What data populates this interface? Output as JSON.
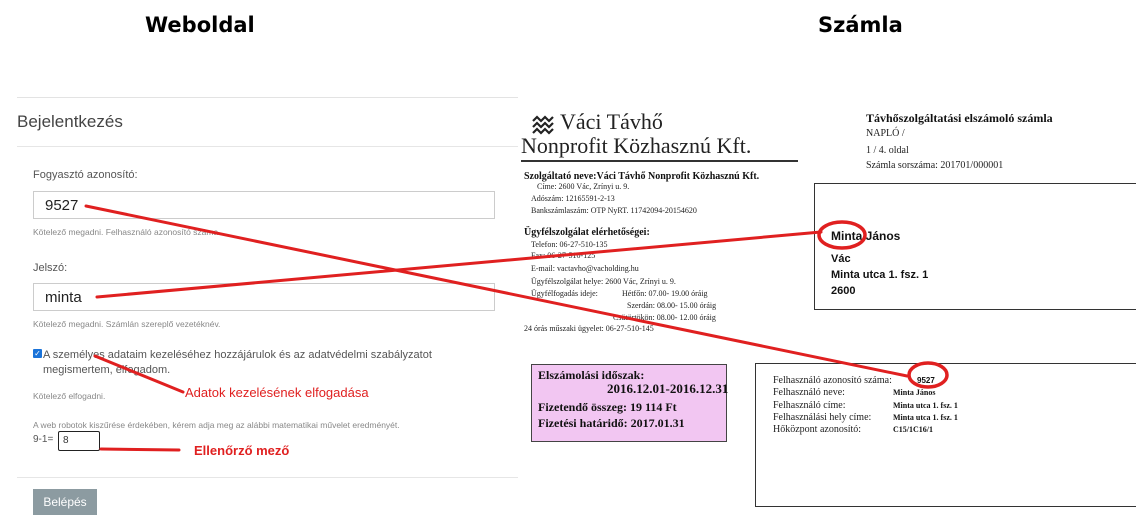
{
  "headings": {
    "left": "Weboldal",
    "right": "Számla"
  },
  "login": {
    "title": "Bejelentkezés",
    "consumer_id_label": "Fogyasztó azonosító:",
    "consumer_id_value": "9527",
    "consumer_id_help": "Kötelező megadni. Felhasználó azonosító száma.",
    "password_label": "Jelszó:",
    "password_value": "minta",
    "password_help": "Kötelező megadni. Számlán szereplő vezetéknév.",
    "consent_text": "A személyes adataim kezeléséhez hozzájárulok és az adatvédelmi szabályzatot megismertem, elfogadom.",
    "consent_help": "Kötelező elfogadni.",
    "captcha_prompt": "A web robotok kiszűrése érdekében, kérem adja meg az alábbi matematikai művelet eredményét.",
    "captcha_equation": "9-1=",
    "captcha_value": "8",
    "login_button": "Belépés"
  },
  "annotations": {
    "consent": "Adatok kezelésének elfogadása",
    "captcha": "Ellenőrző mező",
    "color": "#e02020"
  },
  "invoice": {
    "logo_line1": "Váci Távhő",
    "logo_line2": "Nonprofit Közhasznú Kft.",
    "doc_title": "Távhőszolgáltatási elszámoló számla",
    "naplo": "NAPLÓ /",
    "page": "1 / 4. oldal",
    "serial": "Számla sorszáma:  201701/000001",
    "provider": "Szolgáltató neve:Váci Távhő Nonprofit Közhasznú Kft.",
    "address": "Címe: 2600 Vác, Zrínyi u. 9.",
    "tax_no": "Adószám: 12165591-2-13",
    "bank": "Bankszámlaszám: OTP NyRT. 11742094-20154620",
    "service_head": "Ügyfélszolgálat elérhetőségei:",
    "phone": "Telefon: 06-27-510-135",
    "fax": "Fax: 06-27-510-125",
    "email": "E-mail: vactavho@vacholding.hu",
    "office": "Ügyfélszolgálat helye:   2600 Vác, Zrínyi u. 9.",
    "hours_label": "Ügyfélfogadás ideje:",
    "mon": "Hétfőn:      07.00- 19.00 óráig",
    "wed": "Szerdán:     08.00- 15.00 óráig",
    "thu": "Csütörtökön:    08.00- 12.00 óráig",
    "emergency": "24 órás műszaki ügyelet: 06-27-510-145",
    "customer_name": "Minta János",
    "customer_city": "Vác",
    "customer_street": "Minta utca 1. fsz. 1",
    "customer_zip": "2600",
    "period_label": "Elszámolási időszak:",
    "period_value": "2016.12.01-2016.12.31",
    "amount_label": "Fizetendő összeg:  19 114 Ft",
    "deadline_label": "Fizetési határidő:  2017.01.31",
    "user_id_label": "Felhasználó azonosító száma:",
    "user_id_value": "9527",
    "user_name_label": "Felhasználó neve:",
    "user_name_value": "Minta János",
    "user_addr_label": "Felhasználó címe:",
    "user_addr_value": "Minta utca 1. fsz. 1",
    "site_addr_label": "Felhasználási hely címe:",
    "site_addr_value": "Minta utca 1. fsz. 1",
    "heat_center_label": "Hőközpont azonosító:",
    "heat_center_value": "C15/1C16/1"
  }
}
